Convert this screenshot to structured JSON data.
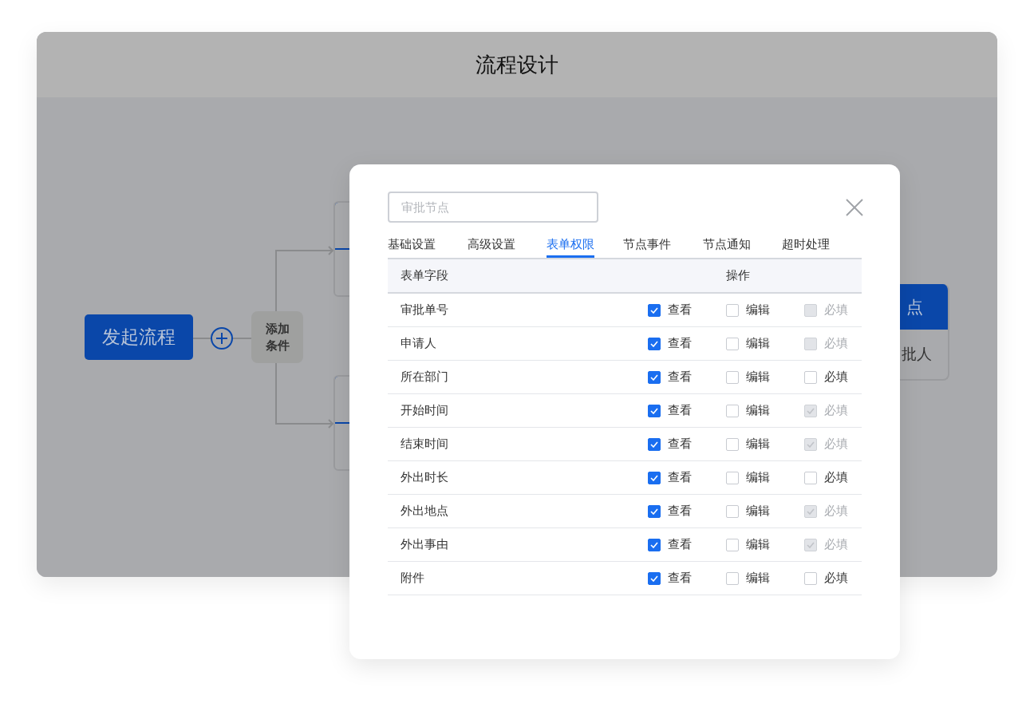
{
  "window": {
    "title": "流程设计"
  },
  "diagram": {
    "start_node": "发起流程",
    "condition_node": {
      "lines": [
        "添加",
        "条件"
      ]
    },
    "right_node": {
      "header": "点",
      "body": "批人"
    }
  },
  "dialog": {
    "name_field": {
      "placeholder": "审批节点"
    },
    "tabs": [
      {
        "label": "基础设置",
        "selected": false
      },
      {
        "label": "高级设置",
        "selected": false
      },
      {
        "label": "表单权限",
        "selected": true
      },
      {
        "label": "节点事件",
        "selected": false
      },
      {
        "label": "节点通知",
        "selected": false
      },
      {
        "label": "超时处理",
        "selected": false
      }
    ],
    "table": {
      "columns": [
        "表单字段",
        "操作"
      ],
      "rows": [
        {
          "field": "审批单号",
          "options": [
            {
              "label": "查看",
              "checked": true,
              "disabled": false
            },
            {
              "label": "编辑",
              "checked": false,
              "disabled": false
            },
            {
              "label": "必填",
              "checked": false,
              "disabled": true
            }
          ]
        },
        {
          "field": "申请人",
          "options": [
            {
              "label": "查看",
              "checked": true,
              "disabled": false
            },
            {
              "label": "编辑",
              "checked": false,
              "disabled": false
            },
            {
              "label": "必填",
              "checked": false,
              "disabled": true
            }
          ]
        },
        {
          "field": "所在部门",
          "options": [
            {
              "label": "查看",
              "checked": true,
              "disabled": false
            },
            {
              "label": "编辑",
              "checked": false,
              "disabled": false
            },
            {
              "label": "必填",
              "checked": false,
              "disabled": false
            }
          ]
        },
        {
          "field": "开始时间",
          "options": [
            {
              "label": "查看",
              "checked": true,
              "disabled": false
            },
            {
              "label": "编辑",
              "checked": false,
              "disabled": false
            },
            {
              "label": "必填",
              "checked": true,
              "disabled": true
            }
          ]
        },
        {
          "field": "结束时间",
          "options": [
            {
              "label": "查看",
              "checked": true,
              "disabled": false
            },
            {
              "label": "编辑",
              "checked": false,
              "disabled": false
            },
            {
              "label": "必填",
              "checked": true,
              "disabled": true
            }
          ]
        },
        {
          "field": "外出时长",
          "options": [
            {
              "label": "查看",
              "checked": true,
              "disabled": false
            },
            {
              "label": "编辑",
              "checked": false,
              "disabled": false
            },
            {
              "label": "必填",
              "checked": false,
              "disabled": false
            }
          ]
        },
        {
          "field": "外出地点",
          "options": [
            {
              "label": "查看",
              "checked": true,
              "disabled": false
            },
            {
              "label": "编辑",
              "checked": false,
              "disabled": false
            },
            {
              "label": "必填",
              "checked": true,
              "disabled": true
            }
          ]
        },
        {
          "field": "外出事由",
          "options": [
            {
              "label": "查看",
              "checked": true,
              "disabled": false
            },
            {
              "label": "编辑",
              "checked": false,
              "disabled": false
            },
            {
              "label": "必填",
              "checked": true,
              "disabled": true
            }
          ]
        },
        {
          "field": "附件",
          "options": [
            {
              "label": "查看",
              "checked": true,
              "disabled": false
            },
            {
              "label": "编辑",
              "checked": false,
              "disabled": false
            },
            {
              "label": "必填",
              "checked": false,
              "disabled": false
            }
          ]
        }
      ]
    }
  }
}
